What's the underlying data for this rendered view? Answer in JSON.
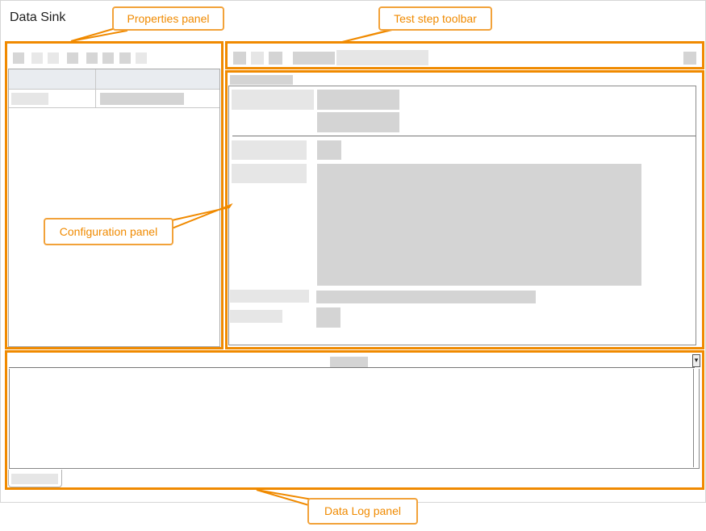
{
  "window": {
    "title": "Data Sink"
  },
  "callouts": {
    "properties_panel": "Properties panel",
    "test_step_toolbar": "Test step toolbar",
    "configuration_panel": "Configuration panel",
    "data_log_panel": "Data Log panel"
  },
  "colors": {
    "highlight": "#f08a00",
    "placeholder": "#d4d4d4"
  }
}
